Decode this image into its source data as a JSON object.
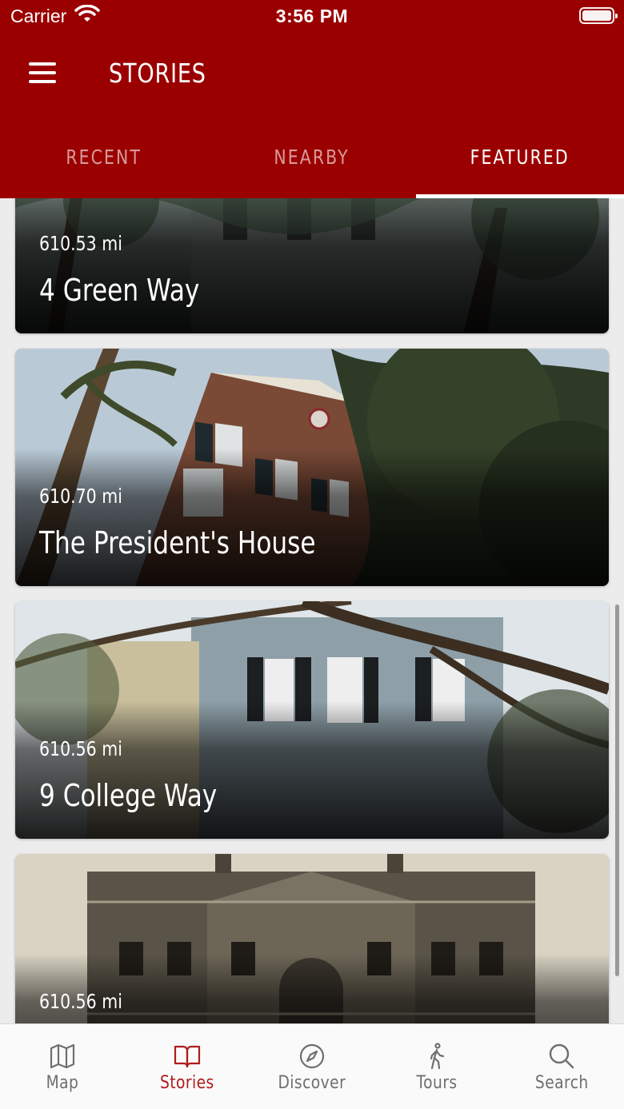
{
  "status_bar": {
    "carrier": "Carrier",
    "time": "3:56 PM"
  },
  "header": {
    "title": "STORIES",
    "tabs": [
      {
        "label": "RECENT",
        "active": false
      },
      {
        "label": "NEARBY",
        "active": false
      },
      {
        "label": "FEATURED",
        "active": true
      }
    ]
  },
  "stories": [
    {
      "distance": "610.53 mi",
      "title": "4 Green Way"
    },
    {
      "distance": "610.70 mi",
      "title": "The President's House"
    },
    {
      "distance": "610.56 mi",
      "title": "9 College Way"
    },
    {
      "distance": "610.56 mi",
      "title": ""
    }
  ],
  "tab_bar": {
    "items": [
      {
        "label": "Map",
        "icon": "map-icon",
        "active": false
      },
      {
        "label": "Stories",
        "icon": "book-icon",
        "active": true
      },
      {
        "label": "Discover",
        "icon": "compass-icon",
        "active": false
      },
      {
        "label": "Tours",
        "icon": "walking-person-icon",
        "active": false
      },
      {
        "label": "Search",
        "icon": "search-icon",
        "active": false
      }
    ]
  },
  "colors": {
    "brand": "#9b0000",
    "tab_active": "#b01c1c",
    "tab_inactive": "#6f6f6f"
  }
}
